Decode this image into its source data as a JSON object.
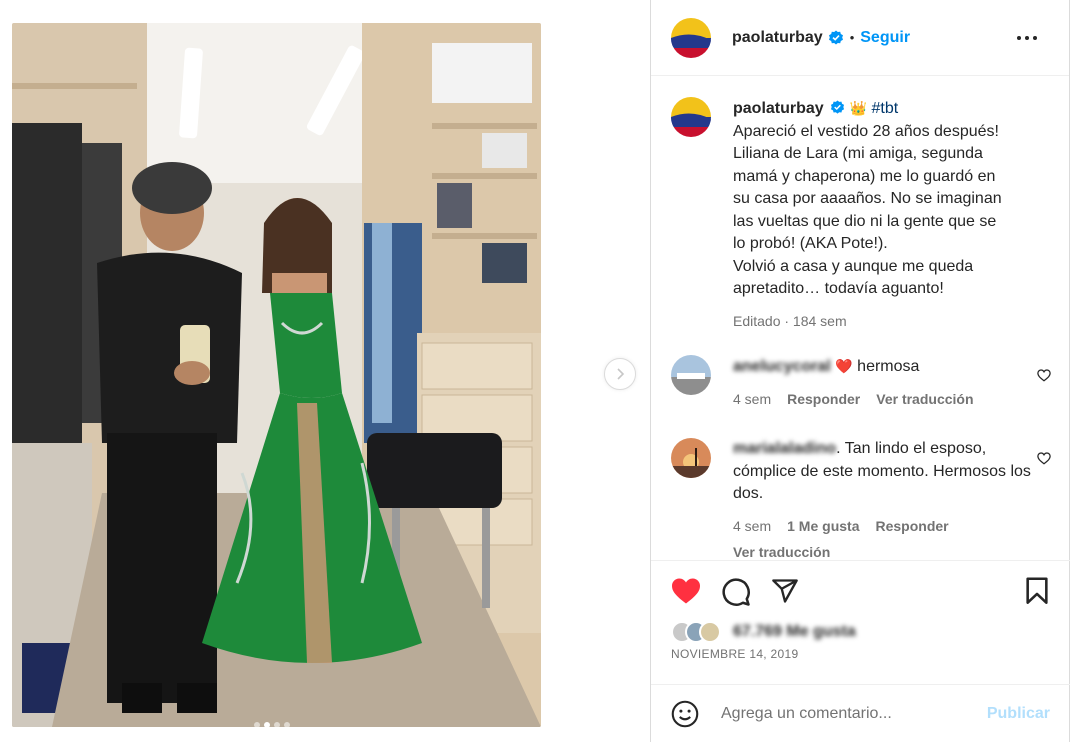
{
  "post": {
    "username": "paolaturbay",
    "follow_label": "Seguir",
    "separator": "•"
  },
  "caption": {
    "username": "paolaturbay",
    "crown": "👑",
    "hashtag": "#tbt",
    "lines": [
      "Apareció el vestido 28 años después!",
      "Liliana de Lara (mi amiga, segunda",
      "mamá y chaperona) me lo guardó en",
      "su casa por aaaaños. No se imaginan",
      "las vueltas que dio ni la gente que se",
      "lo probó! (AKA Pote!).",
      "Volvió a casa y aunque me queda",
      "apretadito… todavía aguanto!"
    ],
    "meta": "Editado · 184 sem"
  },
  "comments": [
    {
      "username": "anelucycoral",
      "emoji": "❤️",
      "text": "hermosa",
      "time": "4 sem",
      "reply": "Responder",
      "translate": "Ver traducción"
    },
    {
      "username": "marialaladino",
      "text_first": ". Tan lindo el",
      "text_rest": "esposo, cómplice de este momento. Hermosos los dos.",
      "time": "4 sem",
      "likes": "1 Me gusta",
      "reply": "Responder",
      "translate": "Ver traducción"
    }
  ],
  "likes": {
    "text": "67.769 Me gusta"
  },
  "date": "NOVIEMBRE 14, 2019",
  "add_comment": {
    "placeholder": "Agrega un comentario...",
    "post_label": "Publicar"
  },
  "colors": {
    "like_red": "#ff3040",
    "link_blue": "#0095f6",
    "dress_green": "#1e8a3a"
  }
}
